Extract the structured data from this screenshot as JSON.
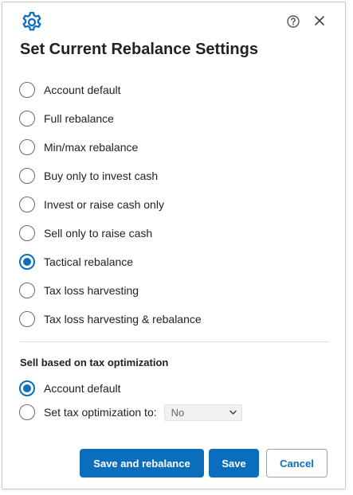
{
  "header": {
    "title": "Set Current Rebalance Settings",
    "icons": {
      "settings": "gear-icon",
      "help": "help-icon",
      "close": "close-icon"
    }
  },
  "rebalance_options": [
    {
      "label": "Account default",
      "selected": false
    },
    {
      "label": "Full rebalance",
      "selected": false
    },
    {
      "label": "Min/max rebalance",
      "selected": false
    },
    {
      "label": "Buy only to invest cash",
      "selected": false
    },
    {
      "label": "Invest or raise cash only",
      "selected": false
    },
    {
      "label": "Sell only to raise cash",
      "selected": false
    },
    {
      "label": "Tactical rebalance",
      "selected": true
    },
    {
      "label": "Tax loss harvesting",
      "selected": false
    },
    {
      "label": "Tax loss harvesting & rebalance",
      "selected": false
    }
  ],
  "tax_section": {
    "title": "Sell based on tax optimization",
    "options": [
      {
        "label": "Account default",
        "selected": true
      },
      {
        "label": "Set tax optimization to:",
        "selected": false
      }
    ],
    "select_value": "No"
  },
  "buttons": {
    "save_and_rebalance": "Save and rebalance",
    "save": "Save",
    "cancel": "Cancel"
  },
  "colors": {
    "accent": "#0a6ebd",
    "text": "#222222",
    "border": "#c9c9c9"
  }
}
